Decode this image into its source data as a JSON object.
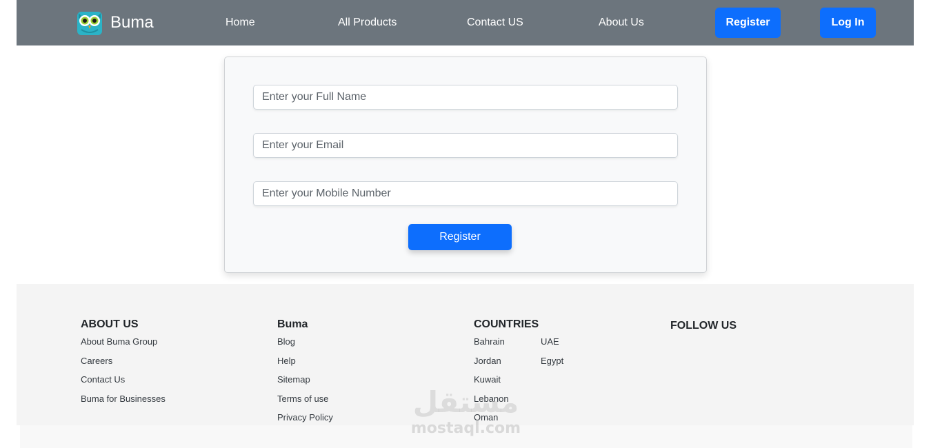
{
  "navbar": {
    "brand_name": "Buma",
    "links": [
      "Home",
      "All Products",
      "Contact US",
      "About Us"
    ],
    "register_label": "Register",
    "login_label": "Log In",
    "background_color": "#6c757d",
    "button_color": "#0d6efd"
  },
  "form": {
    "full_name_placeholder": "Enter your Full Name",
    "email_placeholder": "Enter your Email",
    "mobile_placeholder": "Enter your Mobile Number",
    "submit_label": "Register"
  },
  "footer": {
    "about": {
      "title": "ABOUT US",
      "links": [
        "About Buma Group",
        "Careers",
        "Contact Us",
        "Buma for Businesses"
      ]
    },
    "buma": {
      "title": "Buma",
      "links": [
        "Blog",
        "Help",
        "Sitemap",
        "Terms of use",
        "Privacy Policy"
      ]
    },
    "countries": {
      "title": "COUNTRIES",
      "col1": [
        "Bahrain",
        "Jordan",
        "Kuwait",
        "Lebanon",
        "Oman"
      ],
      "col2": [
        "UAE",
        "Egypt"
      ]
    },
    "follow": {
      "title": "FOLLOW US"
    }
  },
  "watermark": {
    "arabic": "مستقل",
    "latin": "mostaql.com"
  }
}
